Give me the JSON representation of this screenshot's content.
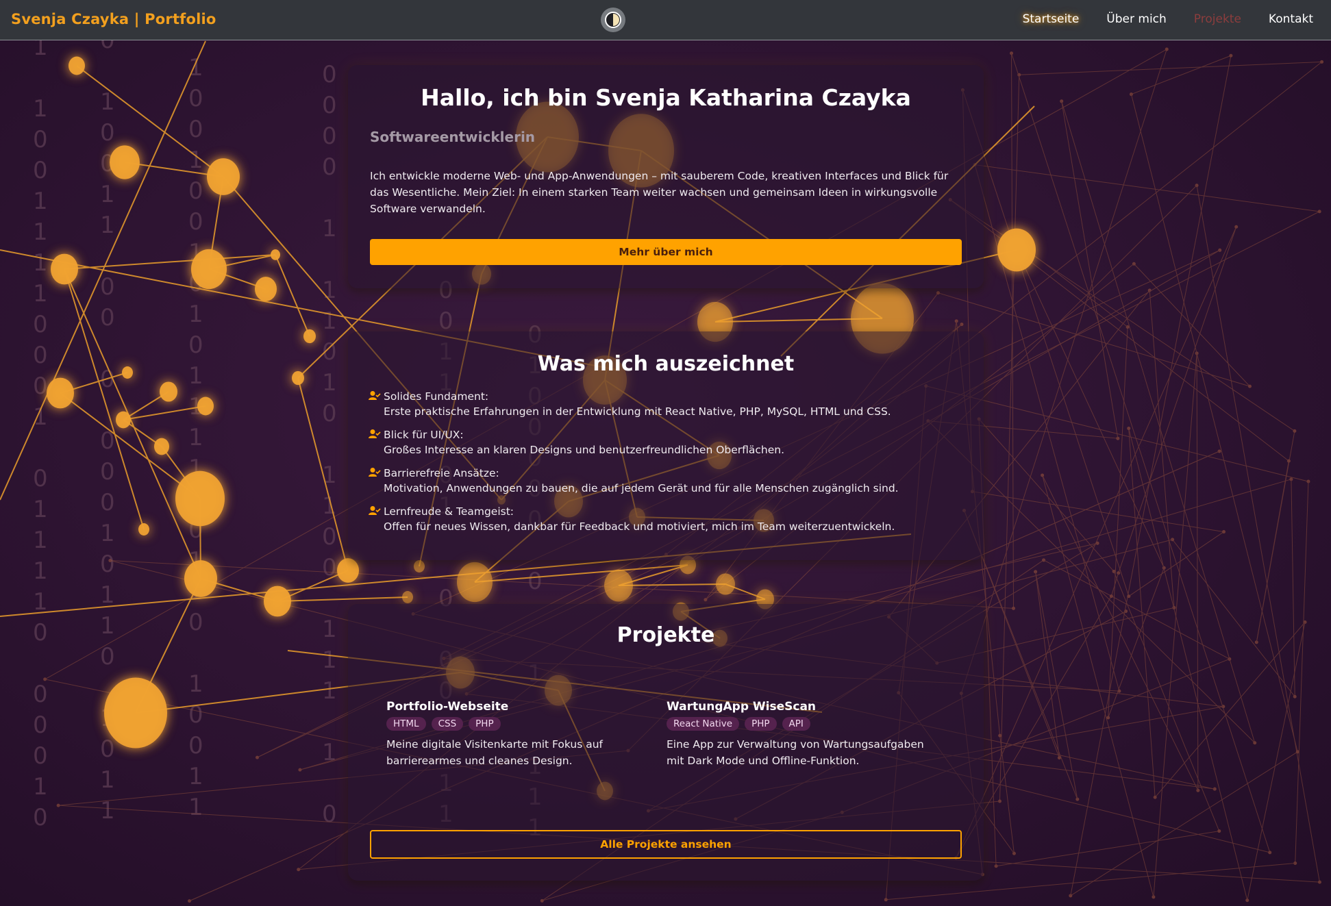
{
  "nav": {
    "brand": "Svenja Czayka | Portfolio",
    "links": [
      "Startseite",
      "Über mich",
      "Projekte",
      "Kontakt"
    ],
    "active": "Projekte"
  },
  "hero": {
    "title": "Hallo, ich bin Svenja Katharina Czayka",
    "subtitle": "Softwareentwicklerin",
    "intro": "Ich entwickle moderne Web- und App-Anwendungen – mit sauberem Code, kreativen Interfaces und Blick für das Wesentliche. Mein Ziel: In einem starken Team weiter wachsen und gemeinsam Ideen in wirkungsvolle Software verwandeln.",
    "button": "Mehr über mich"
  },
  "features": {
    "title": "Was mich auszeichnet",
    "items": [
      {
        "heading": "Solides Fundament:",
        "text": "Erste praktische Erfahrungen in der Entwicklung mit React Native, PHP, MySQL, HTML und CSS."
      },
      {
        "heading": "Blick für UI/UX:",
        "text": "Großes Interesse an klaren Designs und benutzerfreundlichen Oberflächen."
      },
      {
        "heading": "Barrierefreie Ansätze:",
        "text": "Motivation, Anwendungen zu bauen, die auf jedem Gerät und für alle Menschen zugänglich sind."
      },
      {
        "heading": "Lernfreude & Teamgeist:",
        "text": "Offen für neues Wissen, dankbar für Feedback und motiviert, mich im Team weiterzuentwickeln."
      }
    ]
  },
  "projects": {
    "title": "Projekte",
    "items": [
      {
        "title": "Portfolio-Webseite",
        "tags": [
          "HTML",
          "CSS",
          "PHP"
        ],
        "desc": "Meine digitale Visitenkarte mit Fokus auf barrierearmes und cleanes Design."
      },
      {
        "title": "WartungApp WiseScan",
        "tags": [
          "React Native",
          "PHP",
          "API"
        ],
        "desc": "Eine App zur Verwaltung von Wartungsaufgaben mit Dark Mode und Offline-Funktion."
      }
    ],
    "button": "Alle Projekte ansehen"
  },
  "colors": {
    "accent": "#ffa200",
    "brand": "#f3a01e",
    "background": "#2b1330",
    "navbar": "#33363b"
  },
  "icons": {
    "theme_toggle": "half-moon-icon",
    "feature": "user-check-icon"
  }
}
